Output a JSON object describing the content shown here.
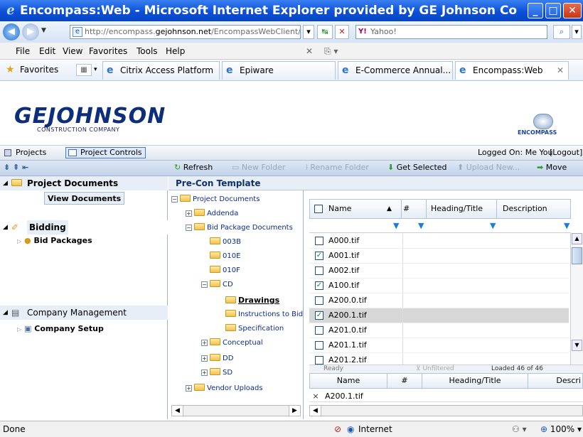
{
  "browser": {
    "title": "Encompass:Web - Microsoft Internet Explorer provided by GE Johnson Cons...",
    "address_prefix": "http://encompass.",
    "address_domain": "gejohnson.net",
    "address_suffix": "/EncompassWebClient/",
    "search_placeholder": "Yahoo!",
    "menu": [
      "File",
      "Edit",
      "View",
      "Favorites",
      "Tools",
      "Help"
    ],
    "favorites_label": "Favorites",
    "tabs": [
      "Citrix Access Platform",
      "Epiware",
      "E-Commerce Annual...",
      "Encompass:Web"
    ],
    "status": "Done",
    "zone": "Internet",
    "zoom": "100%"
  },
  "app": {
    "logo_text": "GEJOHNSON",
    "logo_sub": "CONSTRUCTION COMPANY",
    "brand": "ENCOMPASS",
    "nav_tabs": [
      "Projects",
      "Project Controls"
    ],
    "logged_on": "Logged On: Me You",
    "logout": "[Logout]",
    "toolbar": {
      "refresh": "Refresh",
      "new_folder": "New Folder",
      "rename_folder": "Rename Folder",
      "get_selected": "Get Selected",
      "upload_new": "Upload New...",
      "move": "Move"
    },
    "left": {
      "project_documents": "Project Documents",
      "view_documents": "View Documents",
      "bidding": "Bidding",
      "bid_packages": "Bid Packages",
      "company_management": "Company Management",
      "company_setup": "Company Setup"
    },
    "template_title": "Pre-Con Template",
    "tree": [
      {
        "label": "Project Documents",
        "depth": 0,
        "pm": "-"
      },
      {
        "label": "Addenda",
        "depth": 1,
        "pm": "+"
      },
      {
        "label": "Bid Package Documents",
        "depth": 1,
        "pm": "-"
      },
      {
        "label": "003B",
        "depth": 2,
        "pm": ""
      },
      {
        "label": "010E",
        "depth": 2,
        "pm": ""
      },
      {
        "label": "010F",
        "depth": 2,
        "pm": ""
      },
      {
        "label": "CD",
        "depth": 2,
        "pm": "-"
      },
      {
        "label": "Drawings",
        "depth": 3,
        "pm": ""
      },
      {
        "label": "Instructions to Bid",
        "depth": 3,
        "pm": ""
      },
      {
        "label": "Specification",
        "depth": 3,
        "pm": ""
      },
      {
        "label": "Conceptual",
        "depth": 2,
        "pm": "+"
      },
      {
        "label": "DD",
        "depth": 2,
        "pm": "+"
      },
      {
        "label": "SD",
        "depth": 2,
        "pm": "+"
      },
      {
        "label": "Vendor Uploads",
        "depth": 1,
        "pm": "+"
      }
    ],
    "grid": {
      "columns": [
        "Name",
        "#",
        "Heading/Title",
        "Description"
      ],
      "rows": [
        {
          "name": "A000.tif",
          "checked": false,
          "selected": false
        },
        {
          "name": "A001.tif",
          "checked": true,
          "selected": false
        },
        {
          "name": "A002.tif",
          "checked": false,
          "selected": false
        },
        {
          "name": "A100.tif",
          "checked": true,
          "selected": false
        },
        {
          "name": "A200.0.tif",
          "checked": false,
          "selected": false
        },
        {
          "name": "A200.1.tif",
          "checked": true,
          "selected": true
        },
        {
          "name": "A201.0.tif",
          "checked": false,
          "selected": false
        },
        {
          "name": "A201.1.tif",
          "checked": false,
          "selected": false
        },
        {
          "name": "A201.2.tif",
          "checked": false,
          "selected": false
        }
      ],
      "footer_ready": "Ready",
      "footer_unfiltered": "Unfiltered",
      "footer_loaded": "Loaded 46 of 46"
    },
    "detail": {
      "columns": [
        "Name",
        "#",
        "Heading/Title",
        "Descri"
      ],
      "row_name": "A200.1.tif",
      "remove_glyph": "×"
    }
  }
}
